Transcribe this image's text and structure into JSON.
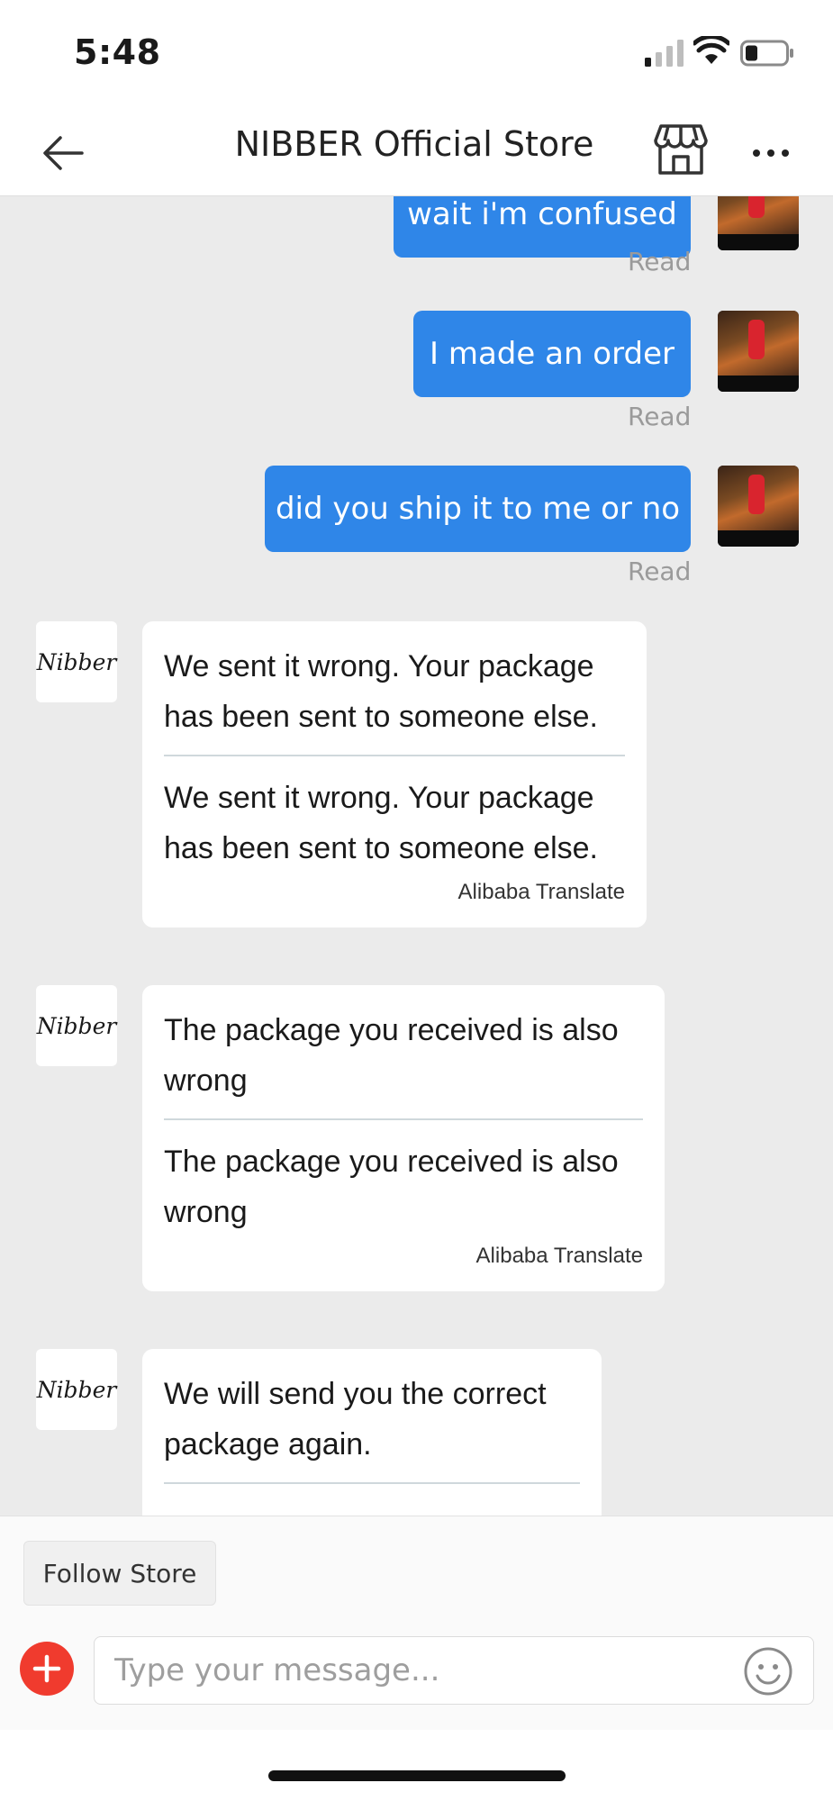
{
  "status_bar": {
    "time": "5:48"
  },
  "header": {
    "title": "NIBBER Official Store"
  },
  "messages_out": [
    {
      "text": "wait i'm confused",
      "status": "Read"
    },
    {
      "text": "I made an order",
      "status": "Read"
    },
    {
      "text": "did you ship it to me or no",
      "status": "Read"
    }
  ],
  "messages_in": [
    {
      "sender": "Nibber",
      "original": "We sent it wrong. Your package has been sent to someone else.",
      "translated": "We sent it wrong. Your package has been sent to someone else.",
      "translate_label": "Alibaba Translate"
    },
    {
      "sender": "Nibber",
      "original": "The package you received is also wrong",
      "translated": "The package you received is also wrong",
      "translate_label": "Alibaba Translate"
    },
    {
      "sender": "Nibber",
      "original": "We will send you the correct package again."
    }
  ],
  "follow_button": "Follow Store",
  "input": {
    "placeholder": "Type your message..."
  },
  "colors": {
    "outgoing_bubble": "#2f86e8",
    "plus_button": "#f03b2e",
    "chat_background": "#ebebeb"
  },
  "icons": {
    "back": "arrow-left-icon",
    "store": "storefront-icon",
    "more": "more-horizontal-icon",
    "add": "plus-circle-icon",
    "emoji": "smiley-icon"
  }
}
